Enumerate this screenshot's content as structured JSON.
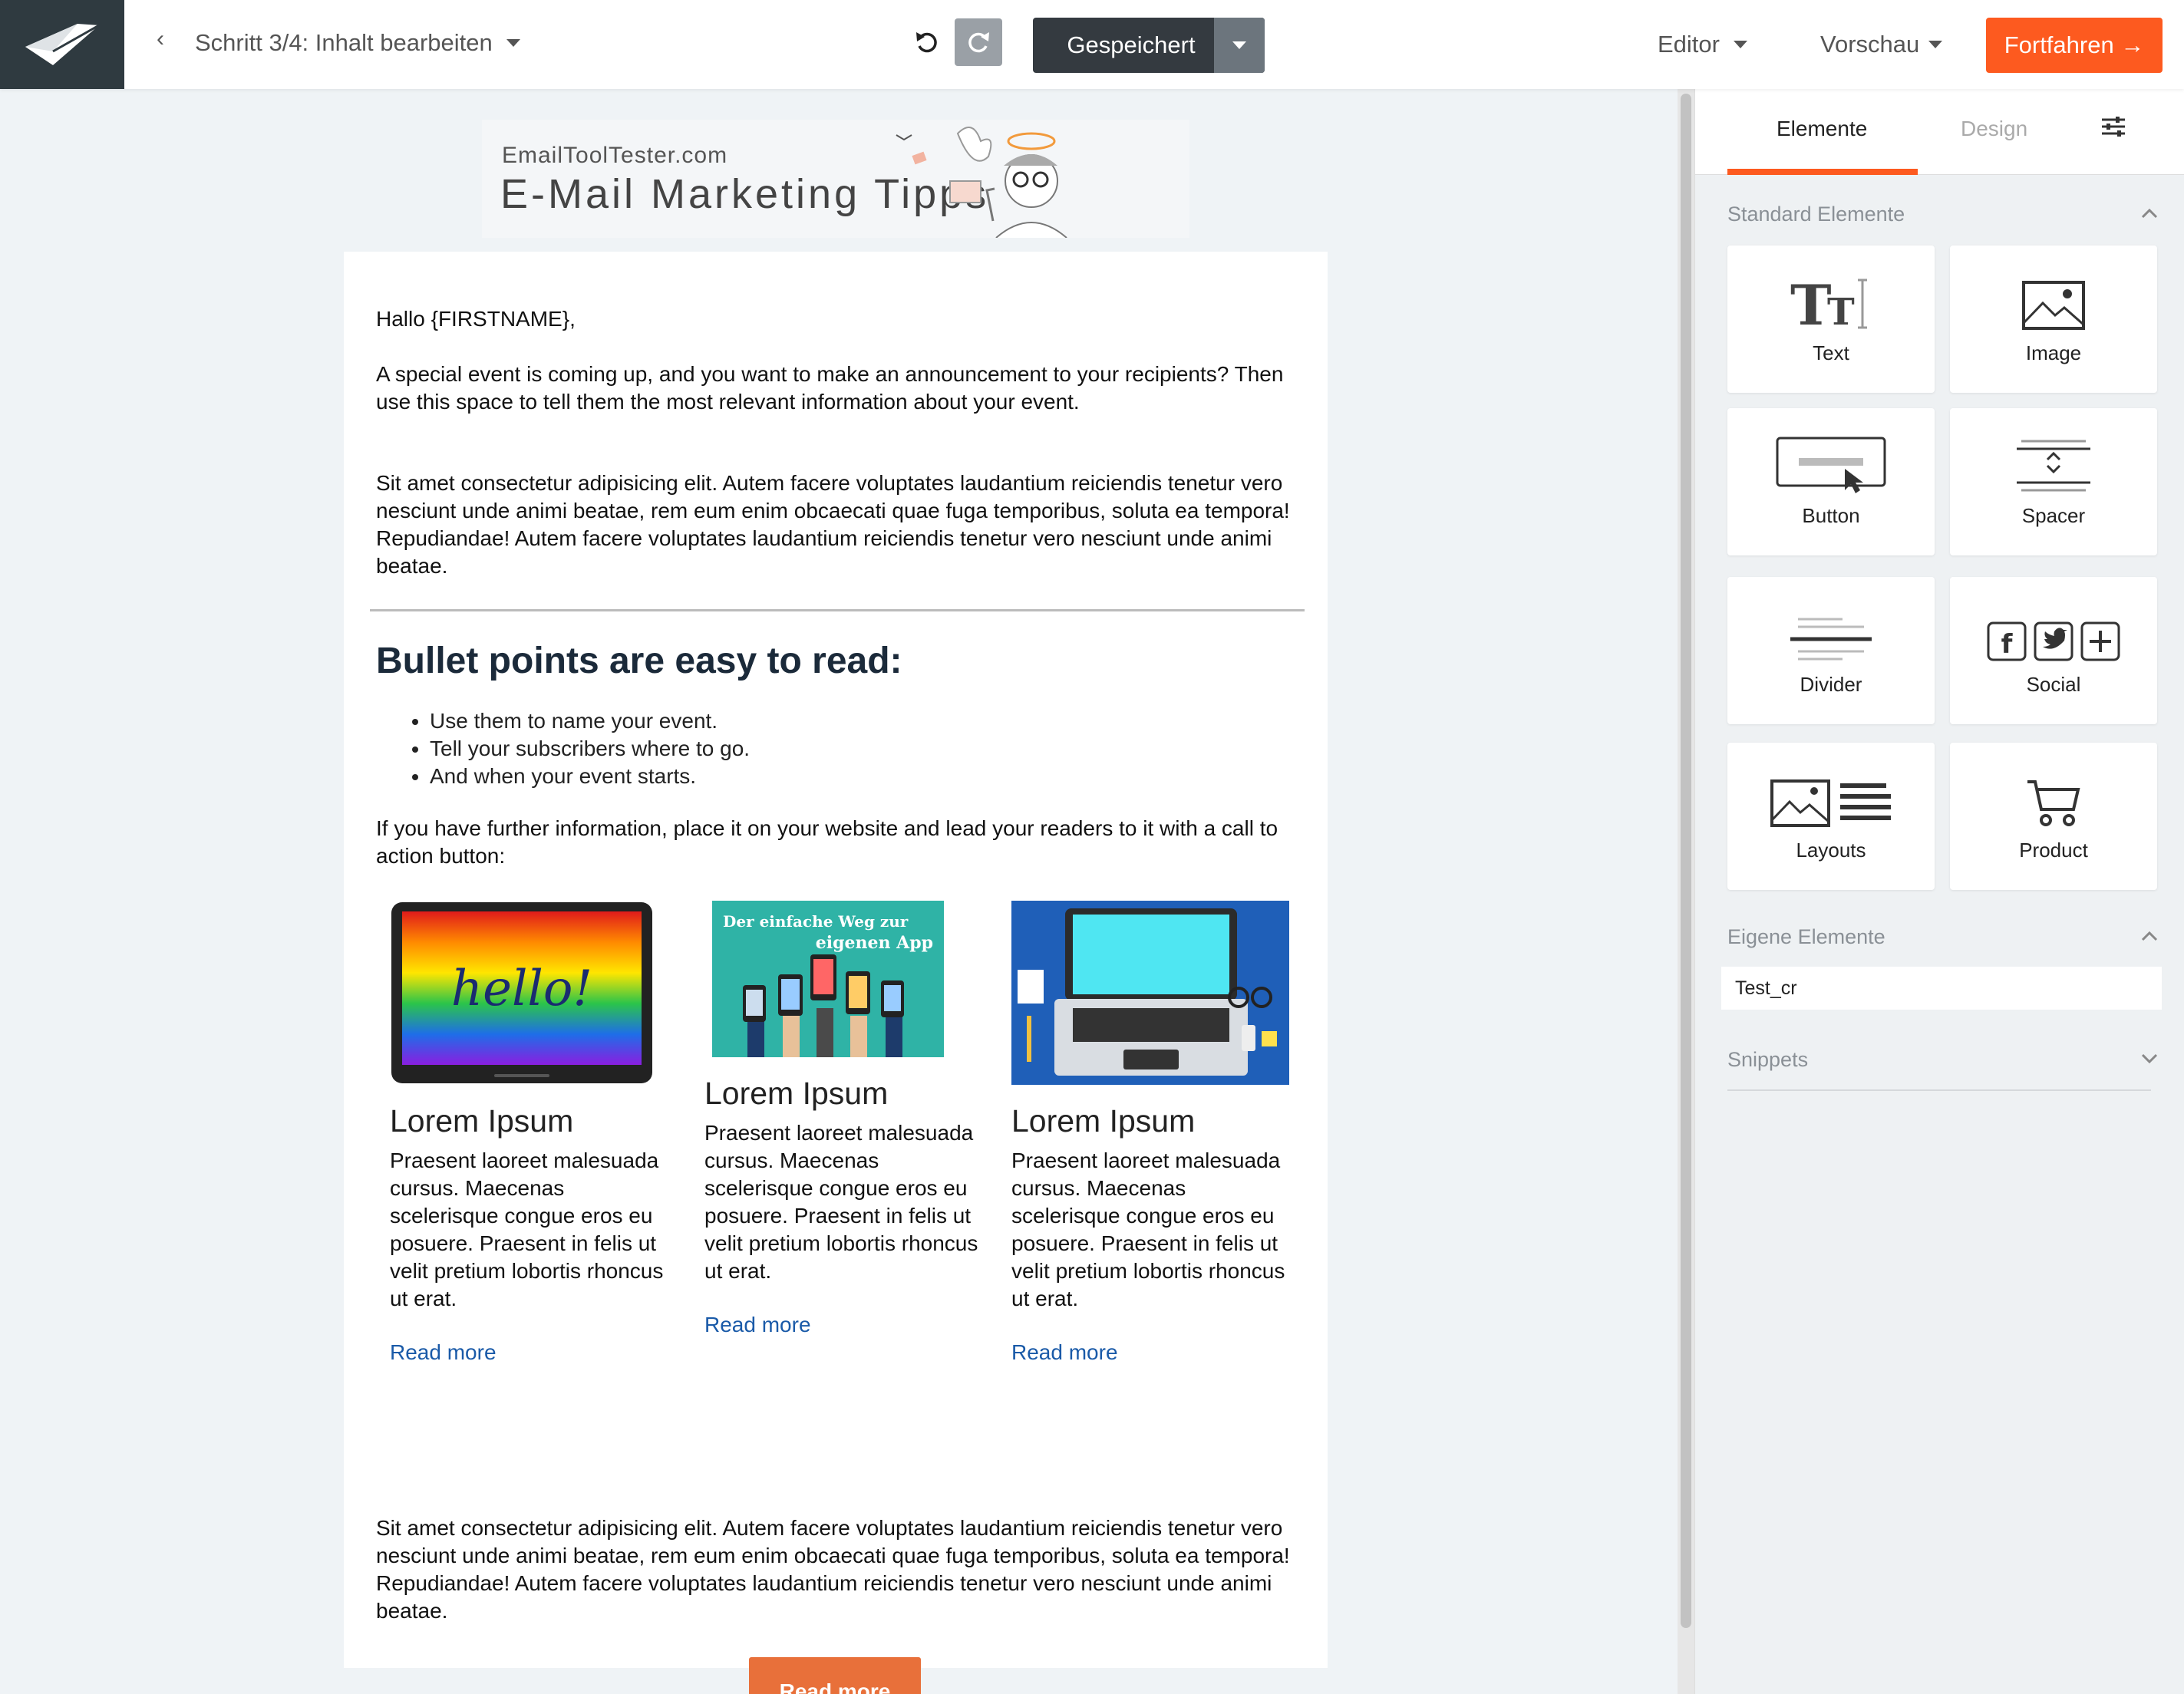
{
  "topbar": {
    "back_label": "‹",
    "step_label": "Schritt 3/4: Inhalt bearbeiten",
    "saved_label": "Gespeichert",
    "editor_label": "Editor",
    "preview_label": "Vorschau",
    "continue_label": "Fortfahren →",
    "accent_color": "#fd5a1f"
  },
  "banner": {
    "site": "EmailToolTester.com",
    "title": "E-Mail Marketing Tipps"
  },
  "email": {
    "greeting": "Hallo {FIRSTNAME},",
    "intro": "A special event is coming up, and you want to make an announcement to your recipients? Then use this space to tell them the most relevant information about your event.",
    "para1": "Sit amet consectetur adipisicing elit. Autem facere voluptates laudantium reiciendis tenetur vero nesciunt unde animi beatae, rem eum enim obcaecati quae fuga temporibus, soluta ea tempora! Repudiandae! Autem facere voluptates laudantium reiciendis tenetur vero nesciunt unde animi beatae.",
    "heading": "Bullet points are easy to read:",
    "bullets": [
      "Use them to name your event.",
      "Tell your subscribers where to go.",
      "And when your event starts."
    ],
    "cta_text": "If you have further information, place it on your website and lead your readers to it with a call to action button:",
    "columns": [
      {
        "title": "Lorem Ipsum",
        "body": "Praesent laoreet malesuada cursus. Maecenas scelerisque congue eros eu posuere. Praesent in felis ut velit pretium lobortis rhoncus ut erat.",
        "link": "Read more",
        "image_text": "hello!"
      },
      {
        "title": "Lorem Ipsum",
        "body": "Praesent laoreet malesuada cursus. Maecenas scelerisque congue eros eu posuere. Praesent in felis ut velit pretium lobortis rhoncus ut erat.",
        "link": "Read more",
        "image_text_1": "Der einfache Weg zur",
        "image_text_2": "eigenen App"
      },
      {
        "title": "Lorem Ipsum",
        "body": "Praesent laoreet malesuada cursus. Maecenas scelerisque congue eros eu posuere. Praesent in felis ut velit pretium lobortis rhoncus ut erat.",
        "link": "Read more"
      }
    ],
    "para2": "Sit amet consectetur adipisicing elit. Autem facere voluptates laudantium reiciendis tenetur vero nesciunt unde animi beatae, rem eum enim obcaecati quae fuga temporibus, soluta ea tempora! Repudiandae! Autem facere voluptates laudantium reiciendis tenetur vero nesciunt unde animi beatae.",
    "button_label": "Read more",
    "button_color": "#e8703a",
    "link_color": "#1a5aa8"
  },
  "sidebar": {
    "tab_elements": "Elemente",
    "tab_design": "Design",
    "standard_title": "Standard Elemente",
    "tiles": [
      "Text",
      "Image",
      "Button",
      "Spacer",
      "Divider",
      "Social",
      "Layouts",
      "Product"
    ],
    "own_title": "Eigene Elemente",
    "own_items": [
      "Test_cr"
    ],
    "snippets_title": "Snippets"
  }
}
